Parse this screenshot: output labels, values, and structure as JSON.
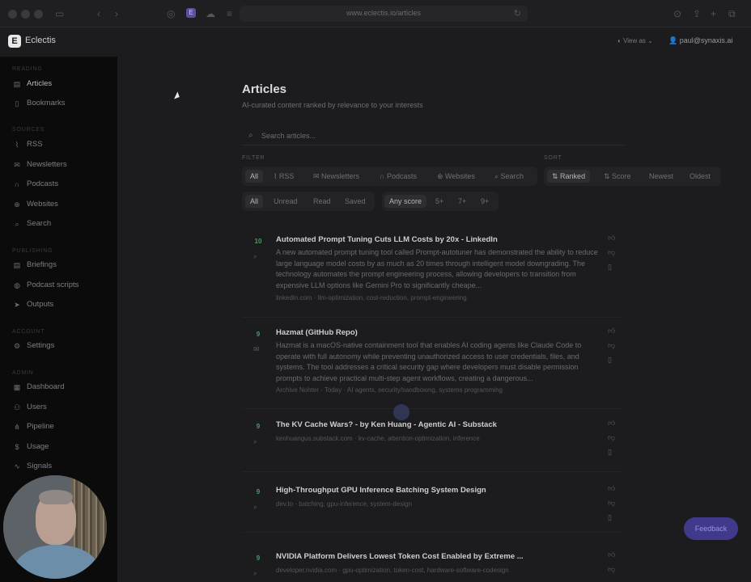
{
  "browser": {
    "url": "www.eclectis.io/articles"
  },
  "header": {
    "logo_letter": "E",
    "brand": "Eclectis",
    "view_as": "View as",
    "user": "paul@synaxis.ai"
  },
  "sidebar": {
    "sections": [
      {
        "label": "READING",
        "items": [
          "Articles",
          "Bookmarks"
        ]
      },
      {
        "label": "SOURCES",
        "items": [
          "RSS",
          "Newsletters",
          "Podcasts",
          "Websites",
          "Search"
        ]
      },
      {
        "label": "PUBLISHING",
        "items": [
          "Briefings",
          "Podcast scripts",
          "Outputs"
        ]
      },
      {
        "label": "ACCOUNT",
        "items": [
          "Settings"
        ]
      },
      {
        "label": "ADMIN",
        "items": [
          "Dashboard",
          "Users",
          "Pipeline",
          "Usage",
          "Signals"
        ]
      }
    ]
  },
  "main": {
    "title": "Articles",
    "subtitle": "AI-curated content ranked by relevance to your interests",
    "search_placeholder": "Search articles...",
    "filter_label": "FILTER",
    "sort_label": "SORT",
    "source_filters": [
      "All",
      "RSS",
      "Newsletters",
      "Podcasts",
      "Websites",
      "Search"
    ],
    "status_filters": [
      "All",
      "Unread",
      "Read",
      "Saved"
    ],
    "score_filters": [
      "Any score",
      "5+",
      "7+",
      "9+"
    ],
    "sorts": [
      "Ranked",
      "Score",
      "Newest",
      "Oldest"
    ]
  },
  "articles": [
    {
      "score": "10",
      "title": "Automated Prompt Tuning Cuts LLM Costs by 20x - LinkedIn",
      "summary": "A new automated prompt tuning tool called Prompt-autotuner has demonstrated the ability to reduce large language model costs by as much as 20 times through intelligent model downgrading. The technology automates the prompt engineering process, allowing developers to transition from expensive LLM options like Gemini Pro to significantly cheape...",
      "meta": "linkedin.com  ·  llm-optimization, cost-reduction, prompt-engineering"
    },
    {
      "score": "9",
      "title": "Hazmat (GitHub Repo)",
      "summary": "Hazmat is a macOS-native containment tool that enables AI coding agents like Claude Code to operate with full autonomy while preventing unauthorized access to user credentials, files, and systems. The tool addresses a critical security gap where developers must disable permission prompts to achieve practical multi-step agent workflows, creating a dangerous...",
      "meta": "Archive Nohter  ·  Today  ·  AI agents, security/sandboxing, systems programming"
    },
    {
      "score": "9",
      "title": "The KV Cache Wars? - by Ken Huang - Agentic AI - Substack",
      "summary": "",
      "meta": "kenhuangus.substack.com  ·  kv-cache, attention-optimization, inference"
    },
    {
      "score": "9",
      "title": "High-Throughput GPU Inference Batching System Design",
      "summary": "",
      "meta": "dev.to  ·  batching, gpu-inference, system-design"
    },
    {
      "score": "9",
      "title": "NVIDIA Platform Delivers Lowest Token Cost Enabled by Extreme ...",
      "summary": "",
      "meta": "developer.nvidia.com  ·  gpu-optimization, token-cost, hardware-software-codesign"
    }
  ],
  "feedback_label": "Feedback"
}
